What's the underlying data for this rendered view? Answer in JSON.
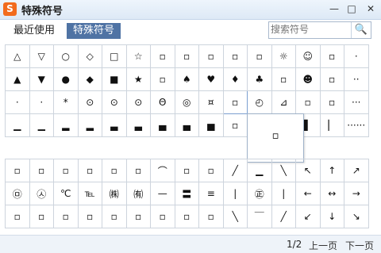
{
  "window": {
    "title": "特殊符号",
    "logo": "S"
  },
  "titlebar_buttons": {
    "minimize": "—",
    "maximize": "□",
    "close": "✕"
  },
  "tabs": [
    {
      "label": "最近使用"
    },
    {
      "label": "特殊符号"
    }
  ],
  "search": {
    "placeholder": "搜索符号",
    "icon": "🔍"
  },
  "grid_top": [
    [
      "△",
      "▽",
      "○",
      "◇",
      "□",
      "☆",
      "▫",
      "▫",
      "▫",
      "▫",
      "▫",
      "☼",
      "☺",
      "▫",
      "·"
    ],
    [
      "▲",
      "▼",
      "●",
      "◆",
      "■",
      "★",
      "▫",
      "♠",
      "♥",
      "♦",
      "♣",
      "▫",
      "☻",
      "▫",
      "··"
    ],
    [
      "·",
      "·",
      "*",
      "⊙",
      "⊙",
      "⊙",
      "Θ",
      "◎",
      "¤",
      "▫",
      "◴",
      "⊿",
      "▫",
      "▫",
      "···"
    ],
    [
      "▁",
      "▁",
      "▂",
      "▂",
      "▃",
      "▃",
      "▄",
      "▄",
      "▅",
      "▫",
      "▫",
      "▫",
      "▌",
      "▏",
      "······"
    ]
  ],
  "popup": {
    "symbol": "▫"
  },
  "grid_bottom": [
    [
      "▫",
      "▫",
      "▫",
      "▫",
      "▫",
      "▫",
      "⌒",
      "▫",
      "▫",
      "╱",
      "▁",
      "╲",
      "↖",
      "↑",
      "↗"
    ],
    [
      "㉤",
      "㉦",
      "℃",
      "℡",
      "㈱",
      "㈪",
      "㈲",
      "—",
      "〓",
      "≡",
      "|",
      "㊣",
      "|",
      "←",
      "↔",
      "→"
    ],
    [
      "▫",
      "▫",
      "▫",
      "▫",
      "▫",
      "▫",
      "▫",
      "▫",
      "▫",
      "╲",
      "￣",
      "╱",
      "↙",
      "↓",
      "↘"
    ]
  ],
  "footer": {
    "page": "1/2",
    "prev": "上一页",
    "next": "下一页"
  }
}
